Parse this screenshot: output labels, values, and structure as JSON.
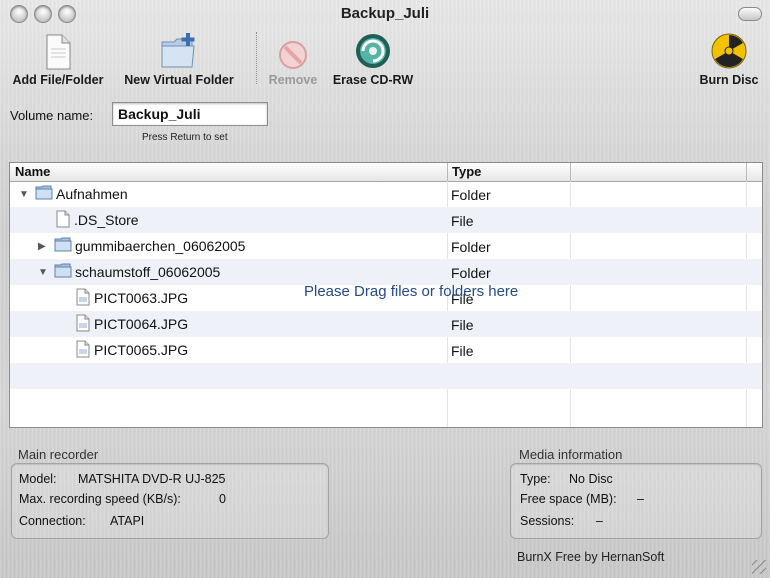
{
  "window": {
    "title": "Backup_Juli"
  },
  "toolbar": {
    "add": "Add File/Folder",
    "new_folder": "New Virtual Folder",
    "remove": "Remove",
    "erase": "Erase CD-RW",
    "burn": "Burn Disc"
  },
  "volume": {
    "label": "Volume name:",
    "value": "Backup_Juli",
    "hint": "Press Return to set"
  },
  "list": {
    "columns": {
      "name": "Name",
      "type": "Type"
    },
    "rows": [
      {
        "name": "Aufnahmen",
        "type": "Folder"
      },
      {
        "name": ".DS_Store",
        "type": "File"
      },
      {
        "name": "gummibaerchen_06062005",
        "type": "Folder"
      },
      {
        "name": "schaumstoff_06062005",
        "type": "Folder"
      },
      {
        "name": "PICT0063.JPG",
        "type": "File"
      },
      {
        "name": "PICT0064.JPG",
        "type": "File"
      },
      {
        "name": "PICT0065.JPG",
        "type": "File"
      }
    ],
    "drop_message": "Please Drag files or folders here"
  },
  "recorder": {
    "title": "Main recorder",
    "model_label": "Model:",
    "model_value": "MATSHITA DVD-R UJ-825",
    "speed_label": "Max. recording speed (KB/s):",
    "speed_value": "0",
    "connection_label": "Connection:",
    "connection_value": "ATAPI"
  },
  "media": {
    "title": "Media information",
    "type_label": "Type:",
    "type_value": "No Disc",
    "free_label": "Free space (MB):",
    "free_value": "–",
    "sessions_label": "Sessions:",
    "sessions_value": "–"
  },
  "credit": "BurnX Free by HernanSoft",
  "colors": {
    "drop_text": "#244a8a",
    "remove_red": "#d9534f",
    "burn_yellow": "#f2c200"
  },
  "icons": [
    "document-icon",
    "folder-add-icon",
    "remove-icon",
    "erase-disc-icon",
    "burn-icon",
    "folder-icon",
    "file-icon",
    "image-file-icon"
  ]
}
